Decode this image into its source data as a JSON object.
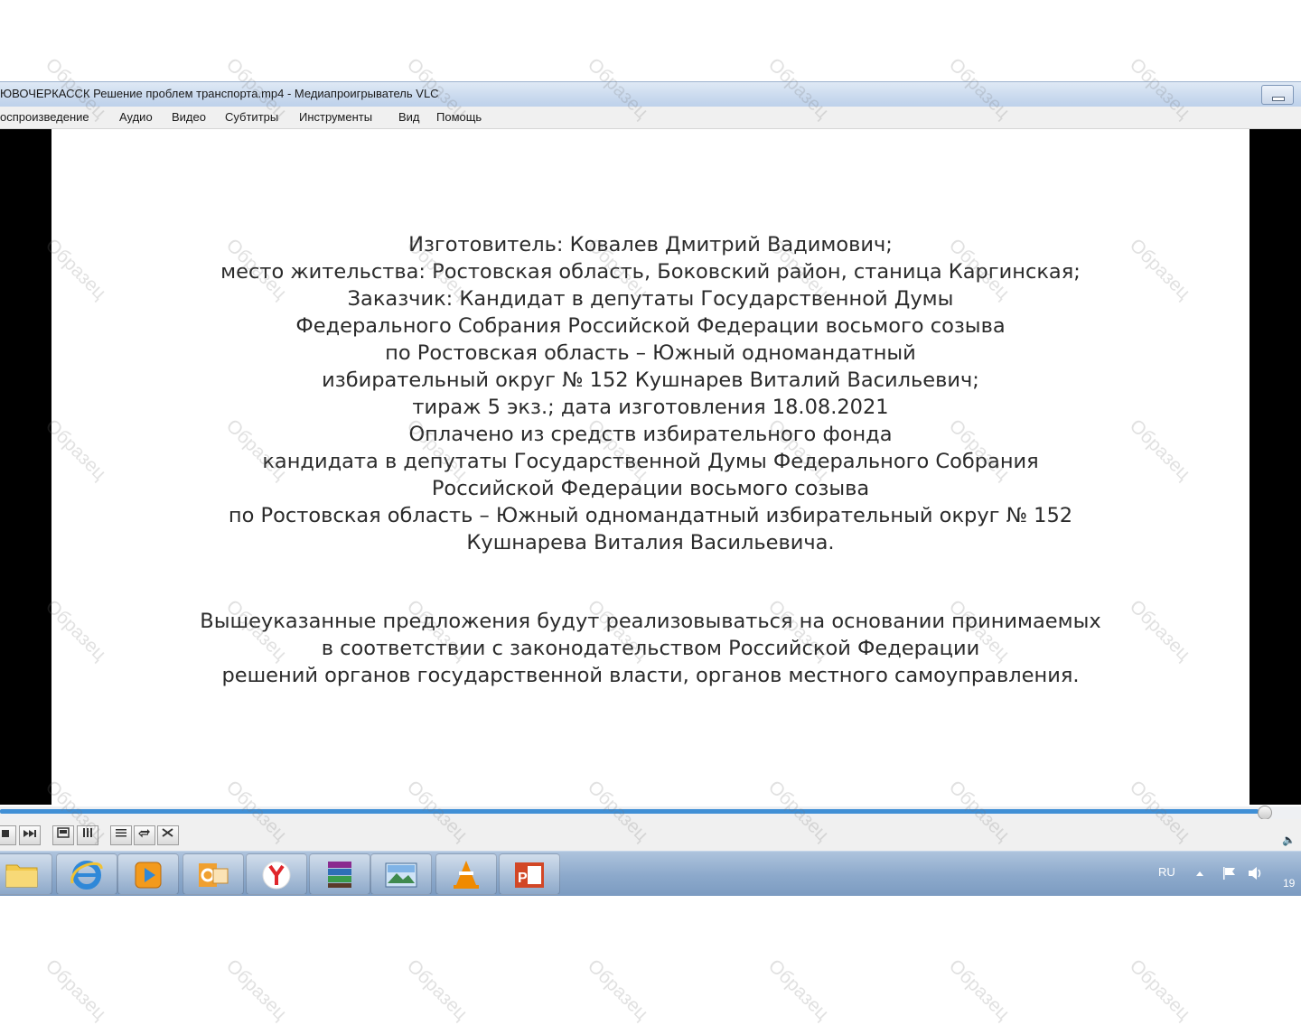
{
  "window": {
    "title": "ЮВОЧЕРКАССК Решение проблем транспорта.mp4 - Медиапроигрыватель VLC"
  },
  "menu": [
    "оспроизведение",
    "Аудио",
    "Видео",
    "Субтитры",
    "Инструменты",
    "Вид",
    "Помощь"
  ],
  "video": {
    "credits": [
      "Изготовитель: Ковалев Дмитрий Вадимович;",
      "место жительства: Ростовская область, Боковский район, станица Каргинская;",
      "Заказчик: Кандидат в депутаты Государственной Думы",
      "Федерального Собрания Российской Федерации восьмого созыва",
      "по Ростовская область – Южный одномандатный",
      "избирательный округ № 152 Кушнарев Виталий Васильевич;",
      "тираж 5 экз.; дата изготовления 18.08.2021",
      "Оплачено из средств избирательного фонда",
      "кандидата в депутаты Государственной Думы Федерального Собрания",
      "Российской Федерации восьмого созыва",
      "по Ростовская область – Южный одномандатный избирательный округ № 152",
      "Кушнарева Виталия Васильевича."
    ],
    "notice": [
      "Вышеуказанные предложения будут реализовываться на основании принимаемых",
      "в соответствии с законодательством Российской Федерации",
      "решений органов государственной власти, органов местного самоуправления."
    ]
  },
  "playback": {
    "progress_percent": 99.2
  },
  "taskbar": {
    "language": "RU",
    "clock": "19",
    "apps": [
      "explorer-icon",
      "internet-explorer-icon",
      "media-player-icon",
      "outlook-icon",
      "yandex-browser-icon",
      "winrar-icon",
      "image-viewer-icon",
      "vlc-icon",
      "powerpoint-icon"
    ]
  },
  "watermark": "Образец",
  "colors": {
    "seek_fill": "#3f8fd6",
    "taskbar": "#8ca9cb",
    "vlc_orange": "#f08a00"
  }
}
